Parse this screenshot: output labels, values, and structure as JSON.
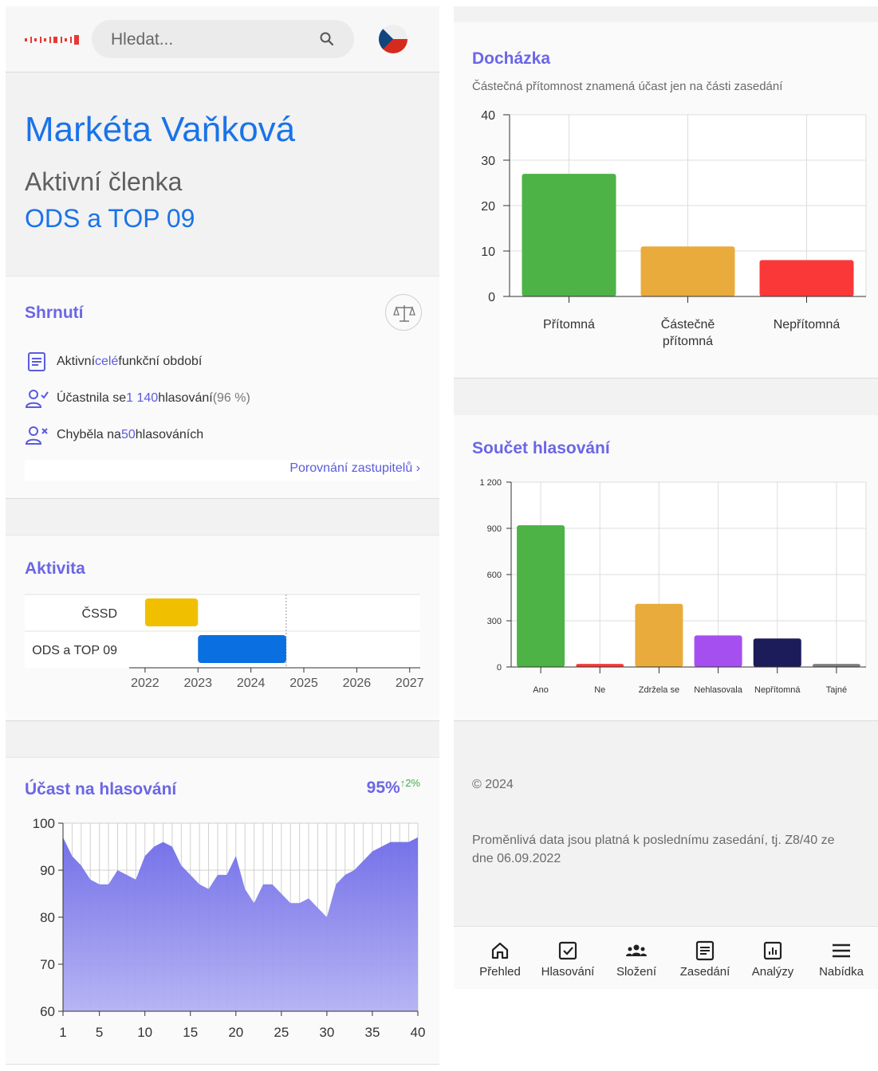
{
  "header": {
    "search_placeholder": "Hledat...",
    "logo_name": "logo",
    "flag_name": "czech-flag"
  },
  "profile": {
    "name": "Markéta Vaňková",
    "role": "Aktivní členka",
    "party": "ODS a TOP 09"
  },
  "summary": {
    "title": "Shrnutí",
    "row1": {
      "a": "Aktivní ",
      "b": "celé",
      "c": " funkční období"
    },
    "row2": {
      "a": "Účastnila se ",
      "b": "1 140",
      "c": " hlasování ",
      "d": "(96 %)"
    },
    "row3": {
      "a": "Chyběla na ",
      "b": "50",
      "c": " hlasováních"
    },
    "link": "Porovnání zastupitelů",
    "link_chevron": "›"
  },
  "activity": {
    "title": "Aktivita",
    "rows": [
      "ČSSD",
      "ODS a TOP 09"
    ],
    "years": [
      "2022",
      "2023",
      "2024",
      "2025",
      "2026",
      "2027"
    ],
    "colors": {
      "cssd": "#f0c000",
      "ods": "#0a6fe0"
    }
  },
  "participation": {
    "title": "Účast na hlasování",
    "rate": "95%",
    "trend": "↑2%",
    "trend_color": "#3cb043"
  },
  "attendance": {
    "title": "Docházka",
    "subtitle": "Částečná přítomnost znamená účast jen na části zasedání"
  },
  "votes": {
    "title": "Součet hlasování"
  },
  "footer": {
    "copyright": "© 2024",
    "note": "Proměnlivá data jsou platná k poslednímu zasedání, tj. Z8/40 ze dne 06.09.2022"
  },
  "nav": [
    {
      "label": "Přehled",
      "icon": "home-icon"
    },
    {
      "label": "Hlasování",
      "icon": "checkbox-icon"
    },
    {
      "label": "Složení",
      "icon": "group-icon"
    },
    {
      "label": "Zasedání",
      "icon": "document-icon"
    },
    {
      "label": "Analýzy",
      "icon": "analytics-icon"
    },
    {
      "label": "Nabídka",
      "icon": "menu-icon"
    }
  ],
  "chart_data": [
    {
      "type": "bar",
      "name": "activity",
      "categories": [
        "ČSSD",
        "ODS a TOP 09"
      ],
      "series": [
        {
          "name": "ČSSD",
          "start": "2022-01",
          "end": "2023-01"
        },
        {
          "name": "ODS a TOP 09",
          "start": "2023-01",
          "end": "2024-09"
        }
      ],
      "xlabels": [
        "2022",
        "2023",
        "2024",
        "2025",
        "2026",
        "2027"
      ],
      "orientation": "horizontal-timeline",
      "current_marker": "2024-09",
      "grid": true
    },
    {
      "type": "area",
      "name": "participation",
      "x": [
        1,
        2,
        3,
        4,
        5,
        6,
        7,
        8,
        9,
        10,
        11,
        12,
        13,
        14,
        15,
        16,
        17,
        18,
        19,
        20,
        21,
        22,
        23,
        24,
        25,
        26,
        27,
        28,
        29,
        30,
        31,
        32,
        33,
        34,
        35,
        36,
        37,
        38,
        39,
        40
      ],
      "values": [
        97,
        93,
        91,
        88,
        87,
        87,
        90,
        89,
        88,
        93,
        95,
        96,
        95,
        91,
        89,
        87,
        86,
        89,
        89,
        93,
        86,
        83,
        87,
        87,
        85,
        83,
        83,
        84,
        82,
        80,
        87,
        89,
        90,
        92,
        94,
        95,
        96,
        96,
        96,
        97
      ],
      "xticks": [
        1,
        5,
        10,
        15,
        20,
        25,
        30,
        35,
        40
      ],
      "ylim": [
        60,
        100
      ],
      "yticks": [
        60,
        70,
        80,
        90,
        100
      ],
      "color": "#7b78ea",
      "grid": true
    },
    {
      "type": "bar",
      "name": "attendance",
      "categories": [
        [
          "Přítomná"
        ],
        [
          "Částečně",
          "přítomná"
        ],
        [
          "Nepřítomná"
        ]
      ],
      "values": [
        27,
        11,
        8
      ],
      "colors": [
        "#4db346",
        "#e9ab3c",
        "#fb3838"
      ],
      "ylim": [
        0,
        40
      ],
      "yticks": [
        0,
        10,
        20,
        30,
        40
      ],
      "grid": true
    },
    {
      "type": "bar",
      "name": "votes",
      "categories": [
        "Ano",
        "Ne",
        "Zdržela se",
        "Nehlasovala",
        "Nepřítomná",
        "Tajné"
      ],
      "values": [
        920,
        20,
        410,
        205,
        185,
        20
      ],
      "colors": [
        "#4db346",
        "#fb3838",
        "#e9ab3c",
        "#a64ff0",
        "#1c1c5a",
        "#7f7f7f"
      ],
      "ylim": [
        0,
        1200
      ],
      "yticks": [
        0,
        300,
        600,
        900,
        1200
      ],
      "ytick_labels": [
        "0",
        "300",
        "600",
        "900",
        "1 200"
      ],
      "grid": true
    }
  ]
}
